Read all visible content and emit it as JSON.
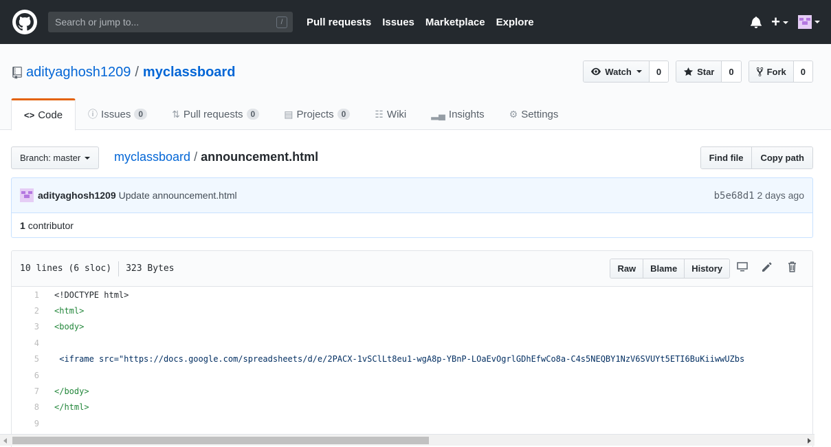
{
  "header": {
    "search_placeholder": "Search or jump to...",
    "search_shortcut": "/",
    "nav": [
      "Pull requests",
      "Issues",
      "Marketplace",
      "Explore"
    ],
    "plus_label": "+"
  },
  "repo": {
    "owner": "adityaghosh1209",
    "separator": "/",
    "name": "myclassboard",
    "watch_label": "Watch",
    "watch_count": "0",
    "star_label": "Star",
    "star_count": "0",
    "fork_label": "Fork",
    "fork_count": "0"
  },
  "tabs": [
    {
      "label": "Code",
      "icon": "code-icon"
    },
    {
      "label": "Issues",
      "count": "0",
      "icon": "issue-icon"
    },
    {
      "label": "Pull requests",
      "count": "0",
      "icon": "pull-request-icon"
    },
    {
      "label": "Projects",
      "count": "0",
      "icon": "project-icon"
    },
    {
      "label": "Wiki",
      "icon": "wiki-icon"
    },
    {
      "label": "Insights",
      "icon": "graph-icon"
    },
    {
      "label": "Settings",
      "icon": "gear-icon"
    }
  ],
  "breadcrumb": {
    "branch_label": "Branch: master",
    "repo_link": "myclassboard",
    "separator": "/",
    "file": "announcement.html",
    "find_file": "Find file",
    "copy_path": "Copy path"
  },
  "commit": {
    "author": "adityaghosh1209",
    "message": "Update announcement.html",
    "sha": "b5e68d1",
    "time": "2 days ago",
    "contributors_count": "1",
    "contributors_label": "contributor"
  },
  "file": {
    "lines_info": "10 lines (6 sloc)",
    "size": "323 Bytes",
    "raw": "Raw",
    "blame": "Blame",
    "history": "History",
    "code_lines": [
      {
        "n": "1",
        "text": "<!DOCTYPE html>"
      },
      {
        "n": "2",
        "text": "<html>"
      },
      {
        "n": "3",
        "text": "<body>"
      },
      {
        "n": "4",
        "text": ""
      },
      {
        "n": "5",
        "text": " <iframe src=\"https://docs.google.com/spreadsheets/d/e/2PACX-1vSClLt8eu1-wgA8p-YBnP-LOaEvOgrlGDhEfwCo8a-C4s5NEQBY1NzV6SVUYt5ETI6BuKiiwwUZbs"
      },
      {
        "n": "6",
        "text": ""
      },
      {
        "n": "7",
        "text": "</body>"
      },
      {
        "n": "8",
        "text": "</html>"
      },
      {
        "n": "9",
        "text": ""
      }
    ]
  }
}
